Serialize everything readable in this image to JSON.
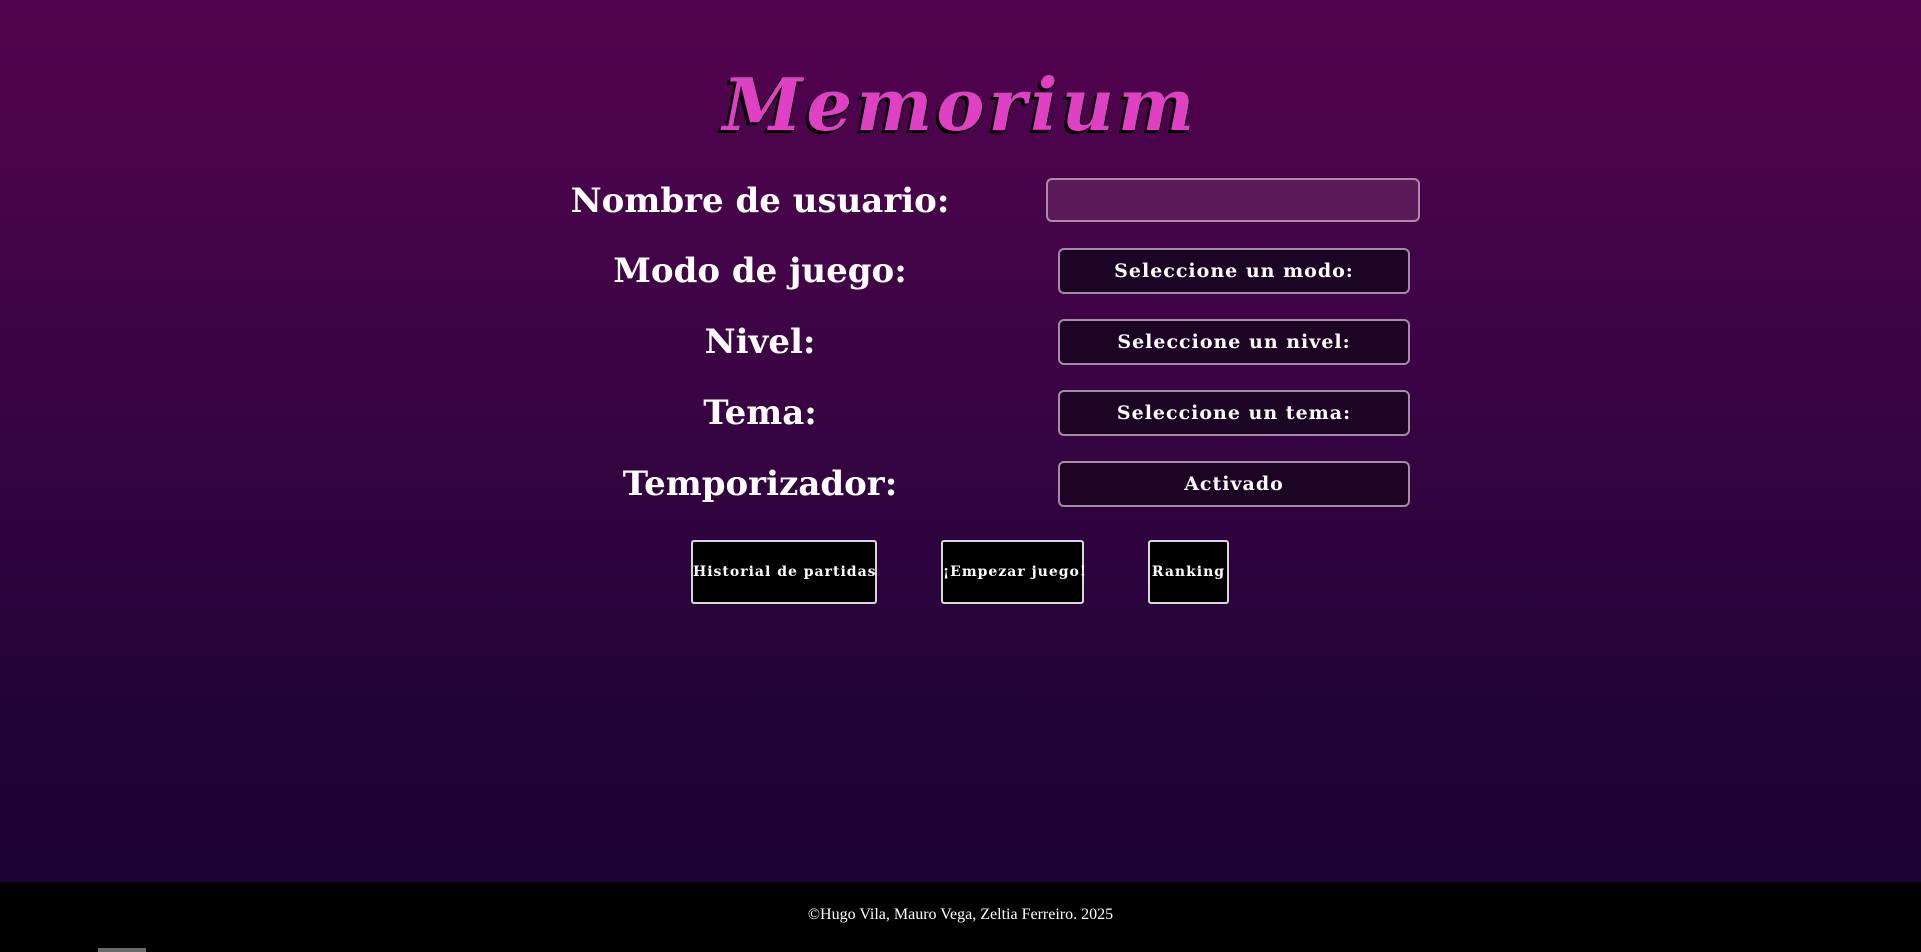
{
  "app": {
    "title": "Memorium"
  },
  "form": {
    "username_label": "Nombre de usuario:",
    "username_value": "",
    "mode_label": "Modo de juego:",
    "mode_button": "Seleccione un modo:",
    "level_label": "Nivel:",
    "level_button": "Seleccione un nivel:",
    "theme_label": "Tema:",
    "theme_button": "Seleccione un tema:",
    "timer_label": "Temporizador:",
    "timer_button": "Activado"
  },
  "actions": {
    "history": "Historial de partidas",
    "start": "¡Empezar juego!",
    "ranking": "Ranking"
  },
  "footer": {
    "text": "©Hugo Vila, Mauro Vega, Zeltia Ferreiro. 2025"
  },
  "colors": {
    "title_accent": "#e040c4",
    "background_top": "#54034f",
    "background_bottom": "#170230",
    "input_bg": "#5a1a5a",
    "select_bg": "#1b0424",
    "footer_bg": "#000000"
  }
}
